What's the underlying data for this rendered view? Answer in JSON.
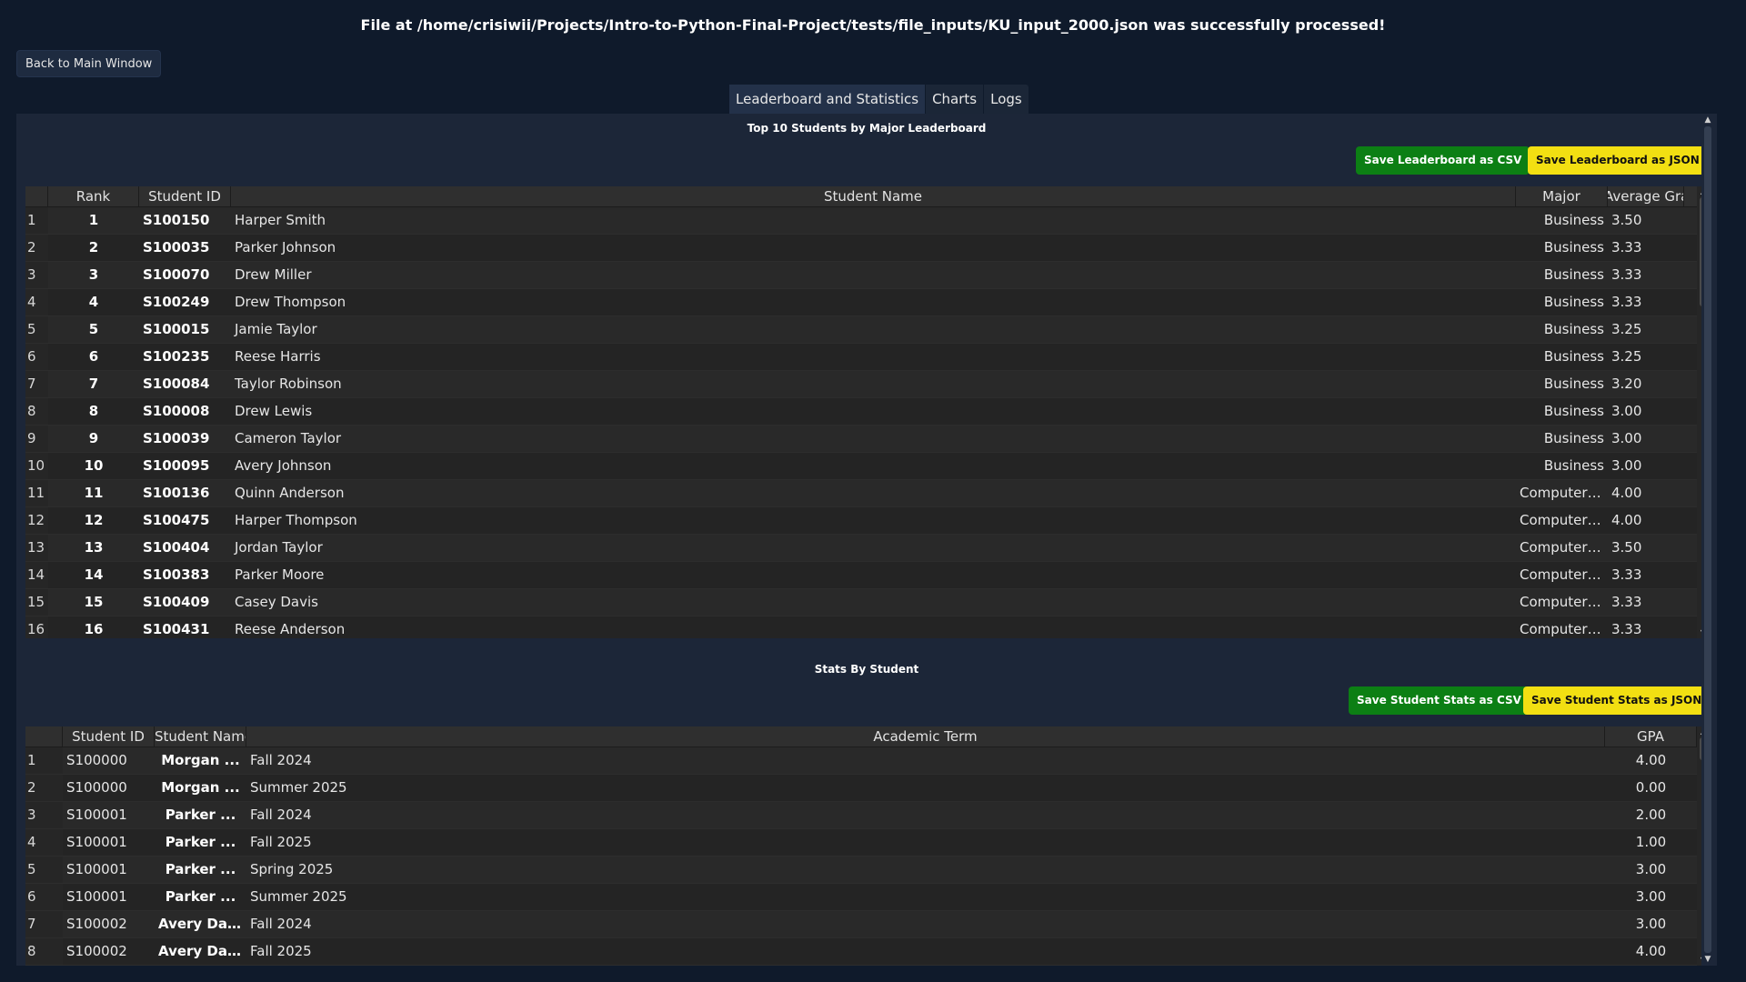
{
  "status_message": "File at /home/crisiwii/Projects/Intro-to-Python-Final-Project/tests/file_inputs/KU_input_2000.json was successfully processed!",
  "back_button": "Back to Main Window",
  "tabs": [
    {
      "label": "Leaderboard and Statistics",
      "active": true
    },
    {
      "label": "Charts",
      "active": false
    },
    {
      "label": "Logs",
      "active": false
    }
  ],
  "leaderboard": {
    "title": "Top 10 Students by Major Leaderboard",
    "save_csv": "Save Leaderboard as CSV",
    "save_json": "Save Leaderboard as JSON",
    "columns": [
      "Rank",
      "Student ID",
      "Student Name",
      "Major",
      "Average Grade"
    ],
    "rows": [
      [
        "1",
        "1",
        "S100150",
        "Harper Smith",
        "Business",
        "3.50"
      ],
      [
        "2",
        "2",
        "S100035",
        "Parker Johnson",
        "Business",
        "3.33"
      ],
      [
        "3",
        "3",
        "S100070",
        "Drew Miller",
        "Business",
        "3.33"
      ],
      [
        "4",
        "4",
        "S100249",
        "Drew Thompson",
        "Business",
        "3.33"
      ],
      [
        "5",
        "5",
        "S100015",
        "Jamie Taylor",
        "Business",
        "3.25"
      ],
      [
        "6",
        "6",
        "S100235",
        "Reese Harris",
        "Business",
        "3.25"
      ],
      [
        "7",
        "7",
        "S100084",
        "Taylor Robinson",
        "Business",
        "3.20"
      ],
      [
        "8",
        "8",
        "S100008",
        "Drew Lewis",
        "Business",
        "3.00"
      ],
      [
        "9",
        "9",
        "S100039",
        "Cameron Taylor",
        "Business",
        "3.00"
      ],
      [
        "10",
        "10",
        "S100095",
        "Avery Johnson",
        "Business",
        "3.00"
      ],
      [
        "11",
        "11",
        "S100136",
        "Quinn Anderson",
        "Computer ...",
        "4.00"
      ],
      [
        "12",
        "12",
        "S100475",
        "Harper Thompson",
        "Computer ...",
        "4.00"
      ],
      [
        "13",
        "13",
        "S100404",
        "Jordan Taylor",
        "Computer ...",
        "3.50"
      ],
      [
        "14",
        "14",
        "S100383",
        "Parker Moore",
        "Computer ...",
        "3.33"
      ],
      [
        "15",
        "15",
        "S100409",
        "Casey Davis",
        "Computer ...",
        "3.33"
      ],
      [
        "16",
        "16",
        "S100431",
        "Reese Anderson",
        "Computer ...",
        "3.33"
      ]
    ]
  },
  "student_stats": {
    "title": "Stats By Student",
    "save_csv": "Save Student Stats as CSV",
    "save_json": "Save Student Stats as JSON",
    "columns": [
      "Student ID",
      "Student Name",
      "Academic Term",
      "GPA"
    ],
    "rows": [
      [
        "1",
        "S100000",
        "Morgan ...",
        "Fall 2024",
        "4.00"
      ],
      [
        "2",
        "S100000",
        "Morgan ...",
        "Summer 2025",
        "0.00"
      ],
      [
        "3",
        "S100001",
        "Parker ...",
        "Fall 2024",
        "2.00"
      ],
      [
        "4",
        "S100001",
        "Parker ...",
        "Fall 2025",
        "1.00"
      ],
      [
        "5",
        "S100001",
        "Parker ...",
        "Spring 2025",
        "3.00"
      ],
      [
        "6",
        "S100001",
        "Parker ...",
        "Summer 2025",
        "3.00"
      ],
      [
        "7",
        "S100002",
        "Avery Davis",
        "Fall 2024",
        "3.00"
      ],
      [
        "8",
        "S100002",
        "Avery Davis",
        "Fall 2025",
        "4.00"
      ]
    ]
  },
  "colors": {
    "background": "#0f1a2b",
    "panel": "#1c2638",
    "csv_button": "#0c7f14",
    "json_button": "#f2df12"
  },
  "icons": {
    "scroll_up": "▲",
    "scroll_down": "▼"
  }
}
